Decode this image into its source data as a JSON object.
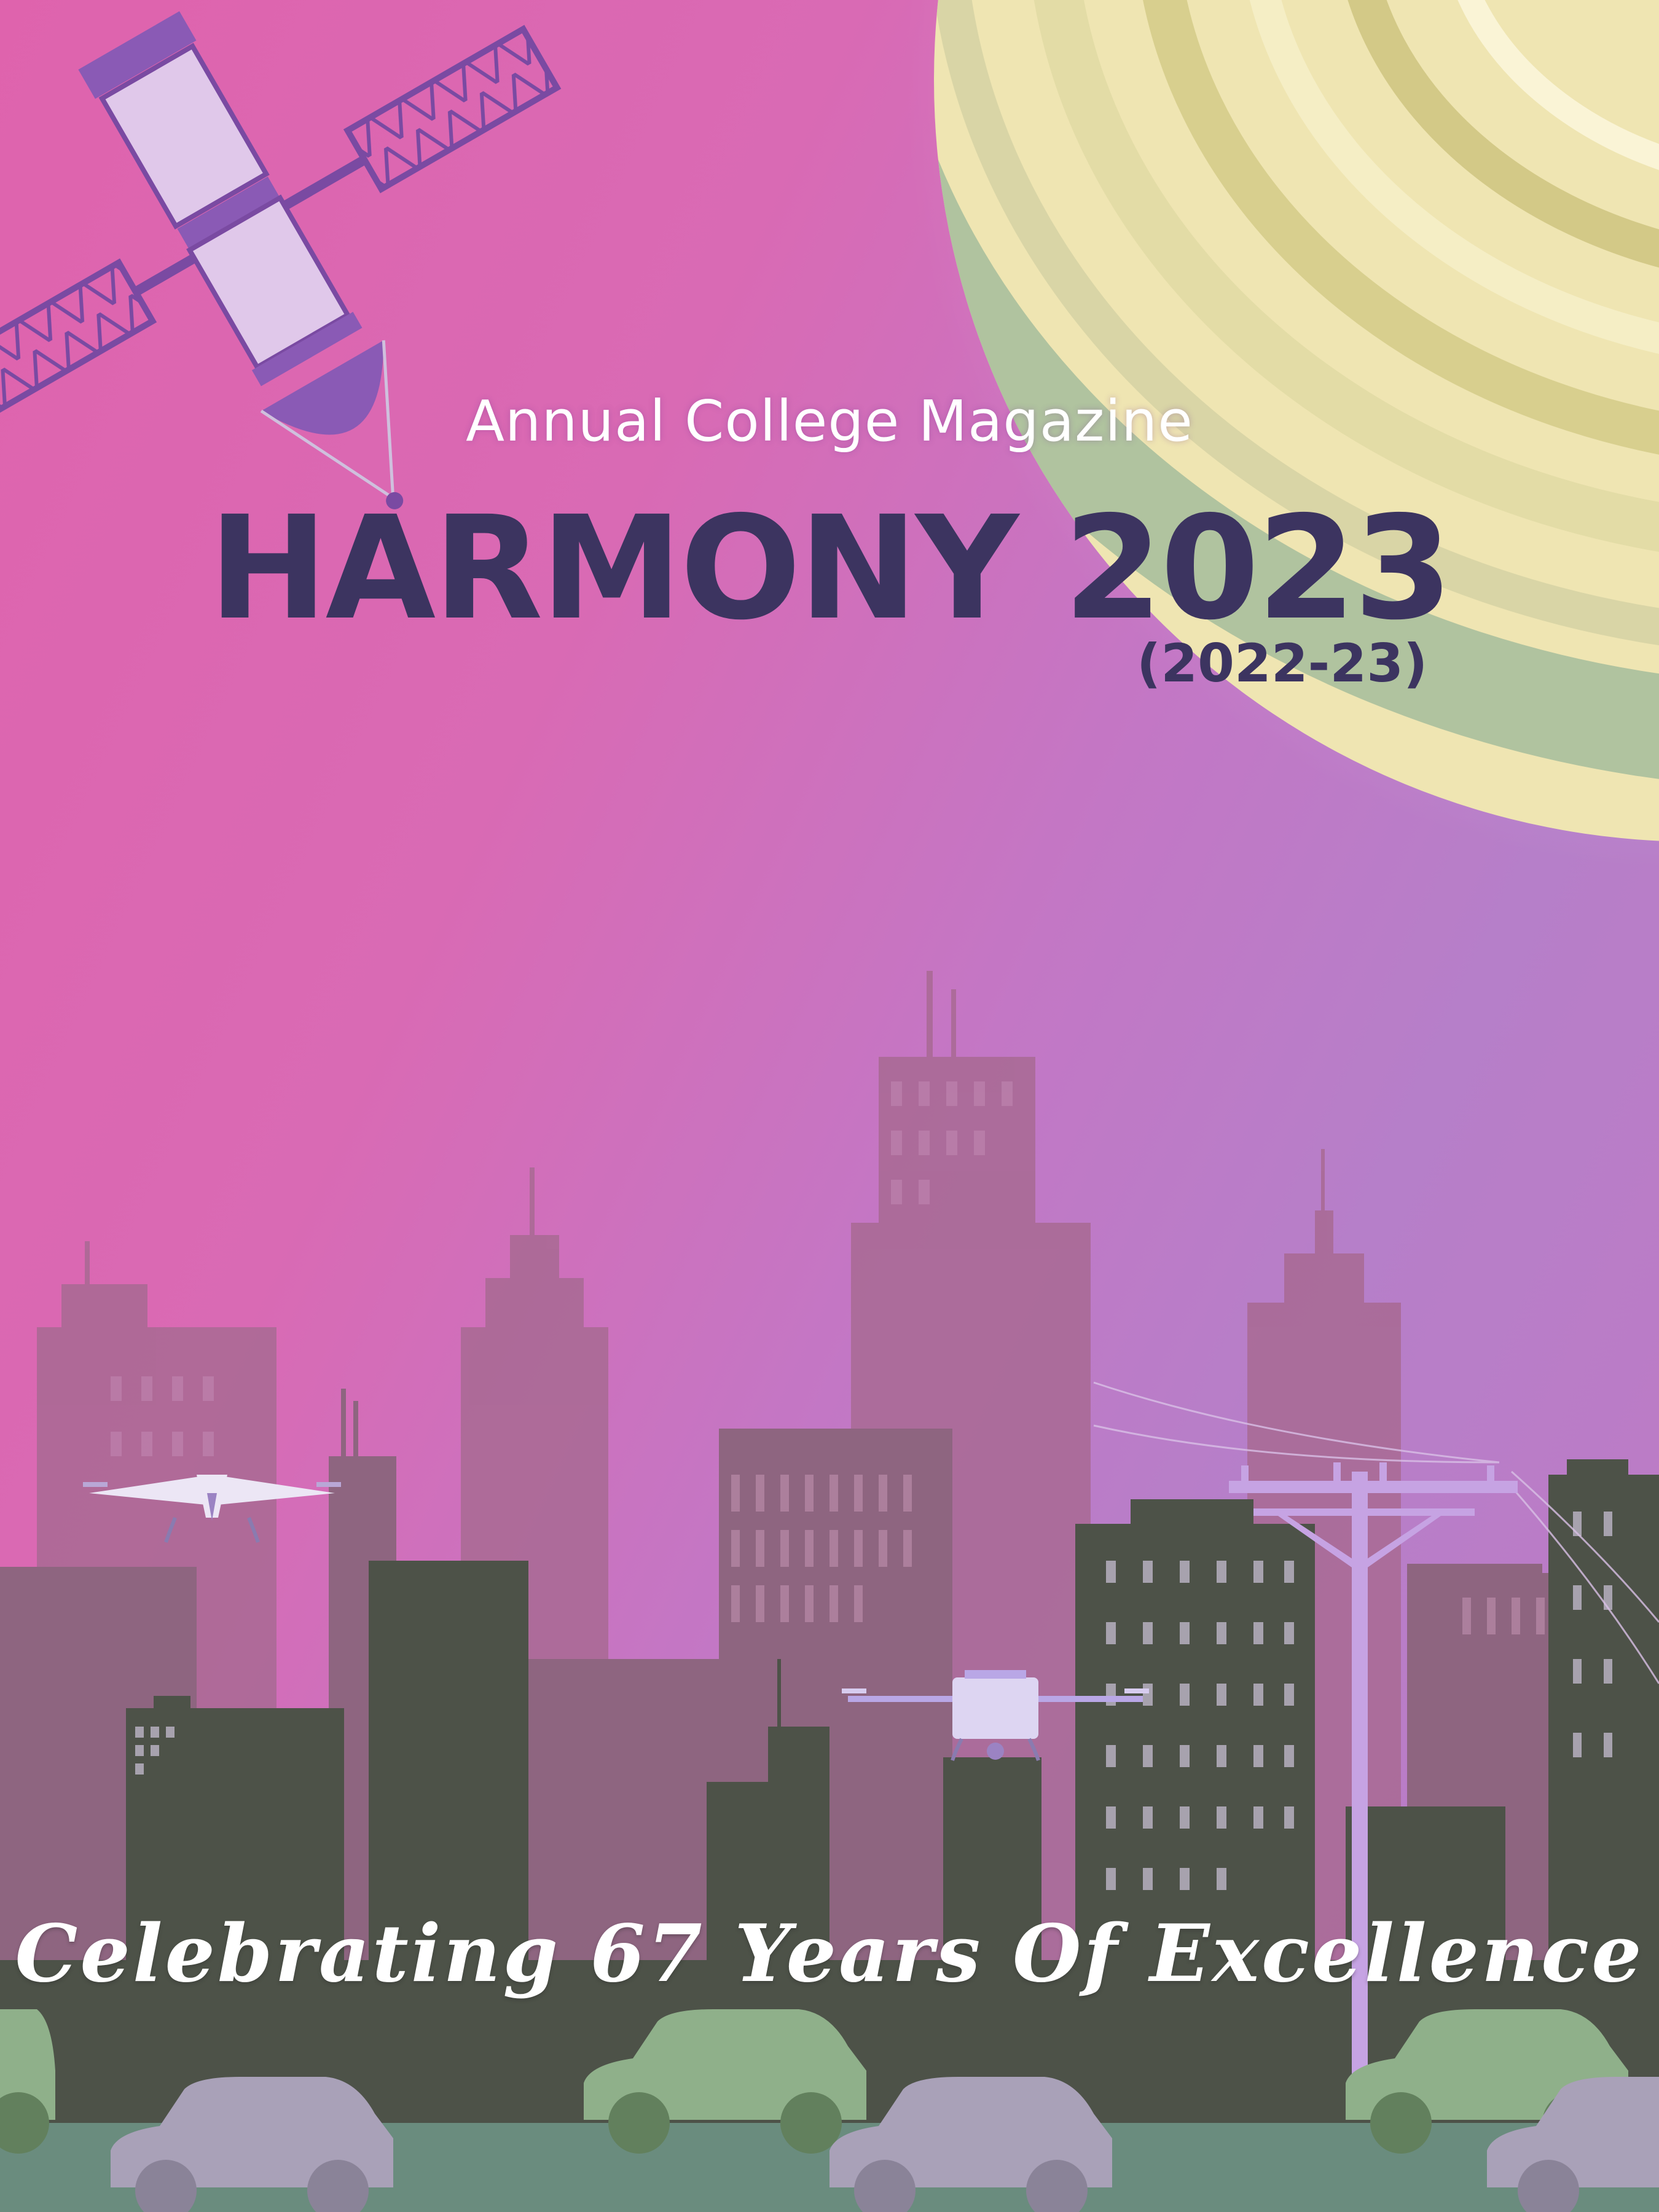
{
  "cover": {
    "subtitle": "Annual College Magazine",
    "title": "HARMONY 2023",
    "academic_year": "(2022-23)",
    "tagline": "Celebrating 67 Years Of Excellence"
  },
  "illustration": {
    "elements": [
      "satellite-icon",
      "planet-icon",
      "city-skyline",
      "drone-icon",
      "utility-pole",
      "car-icon"
    ],
    "colors": {
      "sky_pink": "#df63ad",
      "sky_violet": "#b67fc9",
      "planet_cream": "#efe5b2",
      "planet_green": "#a9bf9c",
      "title_navy": "#3c3460",
      "buildings_back": "#a86a93",
      "buildings_mid": "#8e6580",
      "buildings_front": "#4d5248",
      "road": "#6a8c7e",
      "car_grey": "#a9a1b8",
      "car_green": "#8fb08a"
    }
  }
}
